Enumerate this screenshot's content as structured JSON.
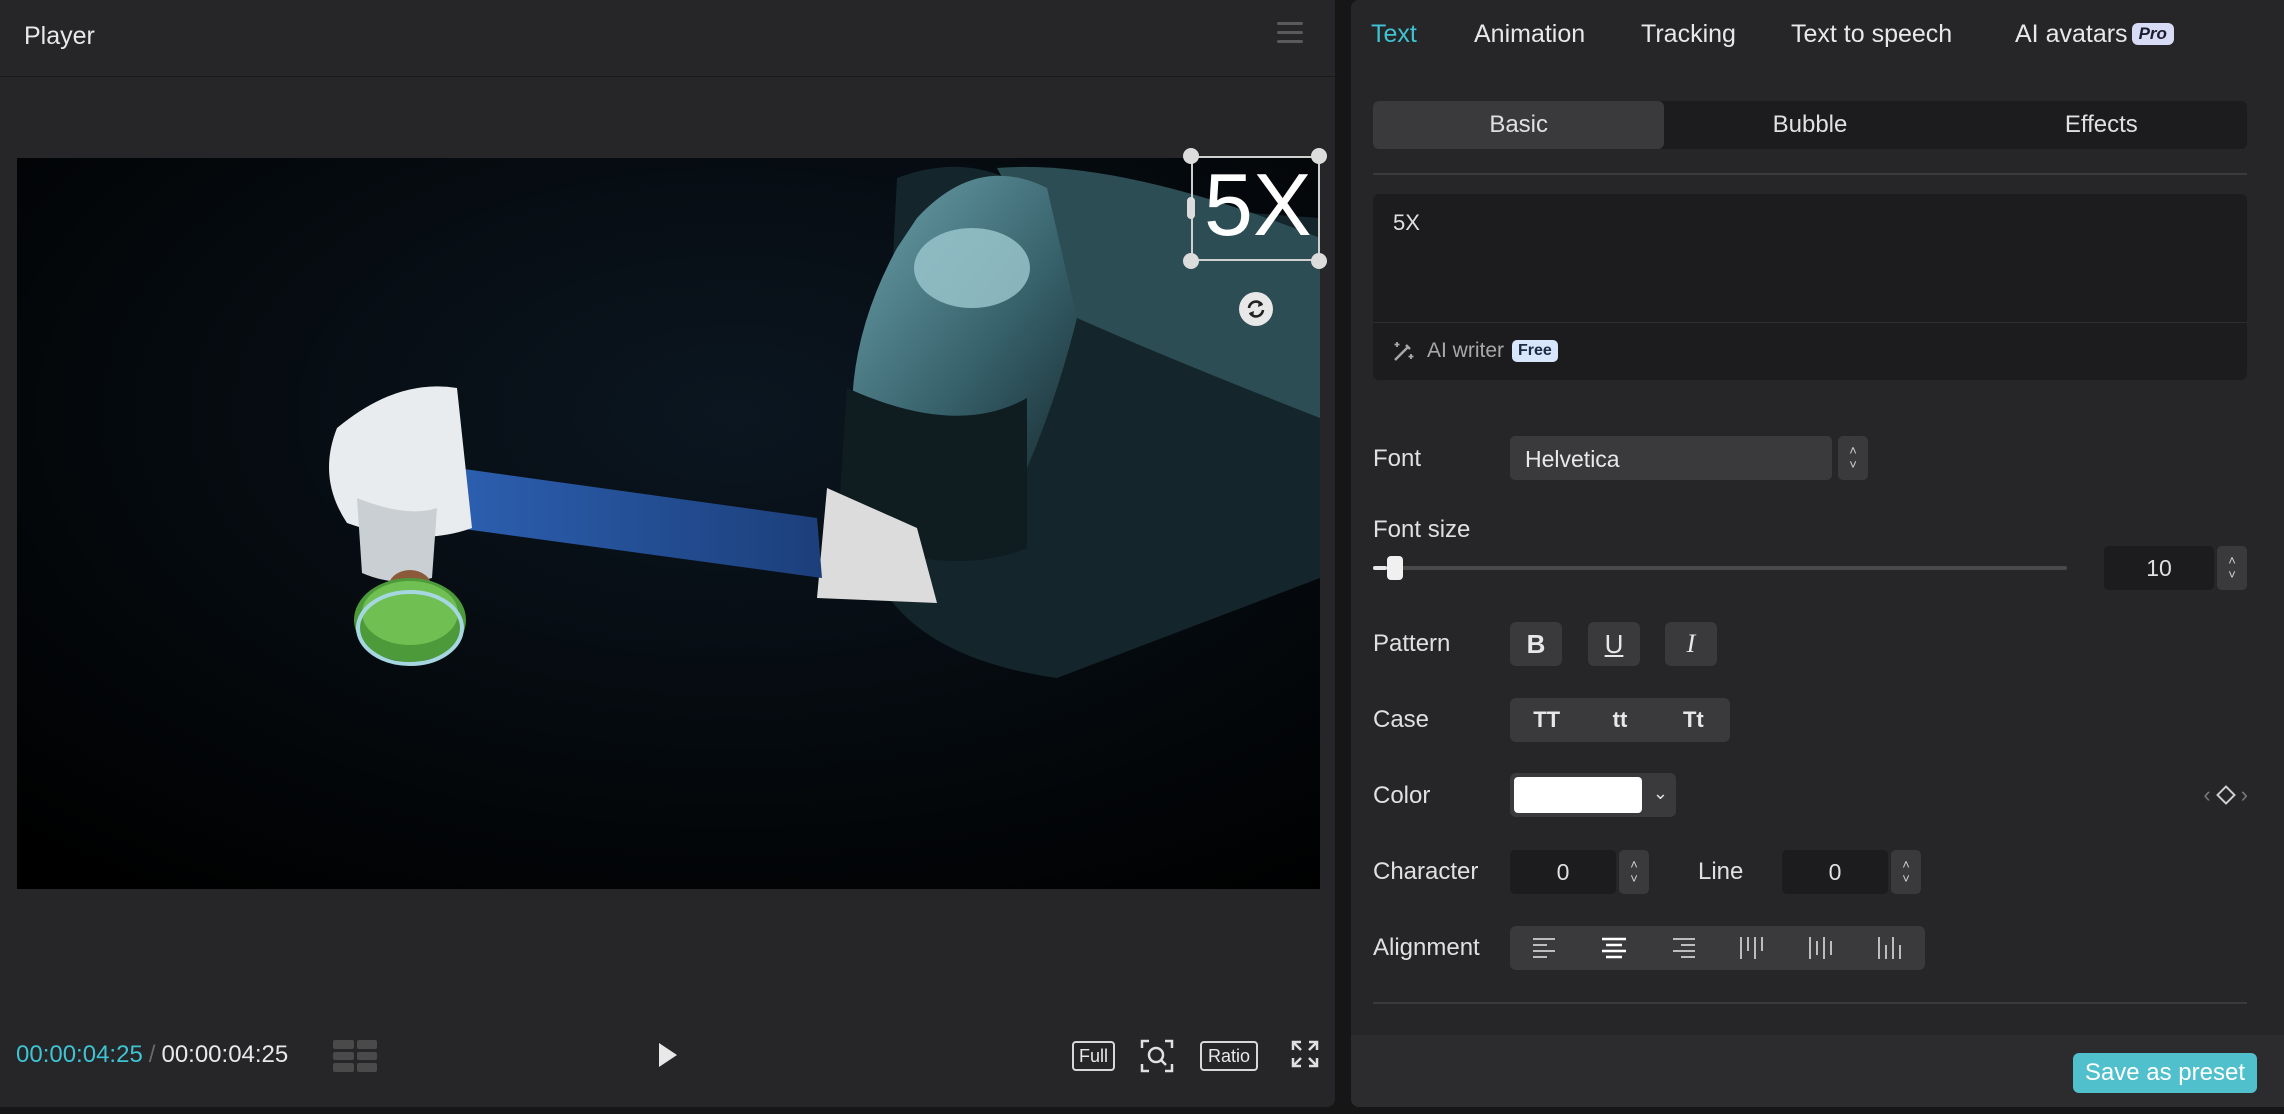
{
  "player": {
    "title": "Player",
    "overlay_text": "5X",
    "current_time": "00:00:04:25",
    "total_time": "00:00:04:25",
    "time_separator": "/",
    "buttons": {
      "full": "Full",
      "ratio": "Ratio"
    }
  },
  "tabs": [
    "Text",
    "Animation",
    "Tracking",
    "Text to speech",
    "AI avatars"
  ],
  "tab_badge": "Pro",
  "subtabs": [
    "Basic",
    "Bubble",
    "Effects"
  ],
  "text_input": {
    "value": "5X"
  },
  "ai_writer": {
    "label": "AI writer",
    "badge": "Free"
  },
  "font": {
    "label": "Font",
    "value": "Helvetica"
  },
  "font_size": {
    "label": "Font size",
    "value": "10",
    "slider_fraction": 0.02
  },
  "pattern": {
    "label": "Pattern",
    "bold": "B",
    "underline": "U",
    "italic": "I"
  },
  "case": {
    "label": "Case",
    "options": [
      "TT",
      "tt",
      "Tt"
    ]
  },
  "color": {
    "label": "Color",
    "value": "#ffffff"
  },
  "spacing": {
    "character_label": "Character",
    "character_value": "0",
    "line_label": "Line",
    "line_value": "0"
  },
  "alignment": {
    "label": "Alignment"
  },
  "save_preset": "Save as preset",
  "accent_color": "#3ec3d2"
}
